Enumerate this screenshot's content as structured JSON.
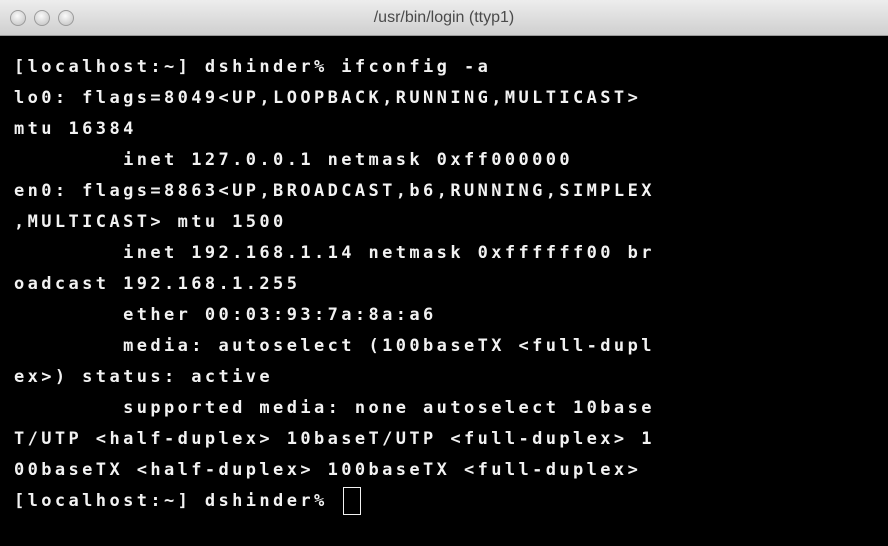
{
  "window": {
    "title": "/usr/bin/login (ttyp1)"
  },
  "terminal": {
    "lines": [
      "[localhost:~] dshinder% ifconfig -a",
      "lo0: flags=8049<UP,LOOPBACK,RUNNING,MULTICAST>",
      "mtu 16384",
      "        inet 127.0.0.1 netmask 0xff000000",
      "en0: flags=8863<UP,BROADCAST,b6,RUNNING,SIMPLEX",
      ",MULTICAST> mtu 1500",
      "        inet 192.168.1.14 netmask 0xffffff00 br",
      "oadcast 192.168.1.255",
      "        ether 00:03:93:7a:8a:a6",
      "        media: autoselect (100baseTX <full-dupl",
      "ex>) status: active",
      "        supported media: none autoselect 10base",
      "T/UTP <half-duplex> 10baseT/UTP <full-duplex> 1",
      "00baseTX <half-duplex> 100baseTX <full-duplex>",
      "[localhost:~] dshinder% "
    ]
  }
}
